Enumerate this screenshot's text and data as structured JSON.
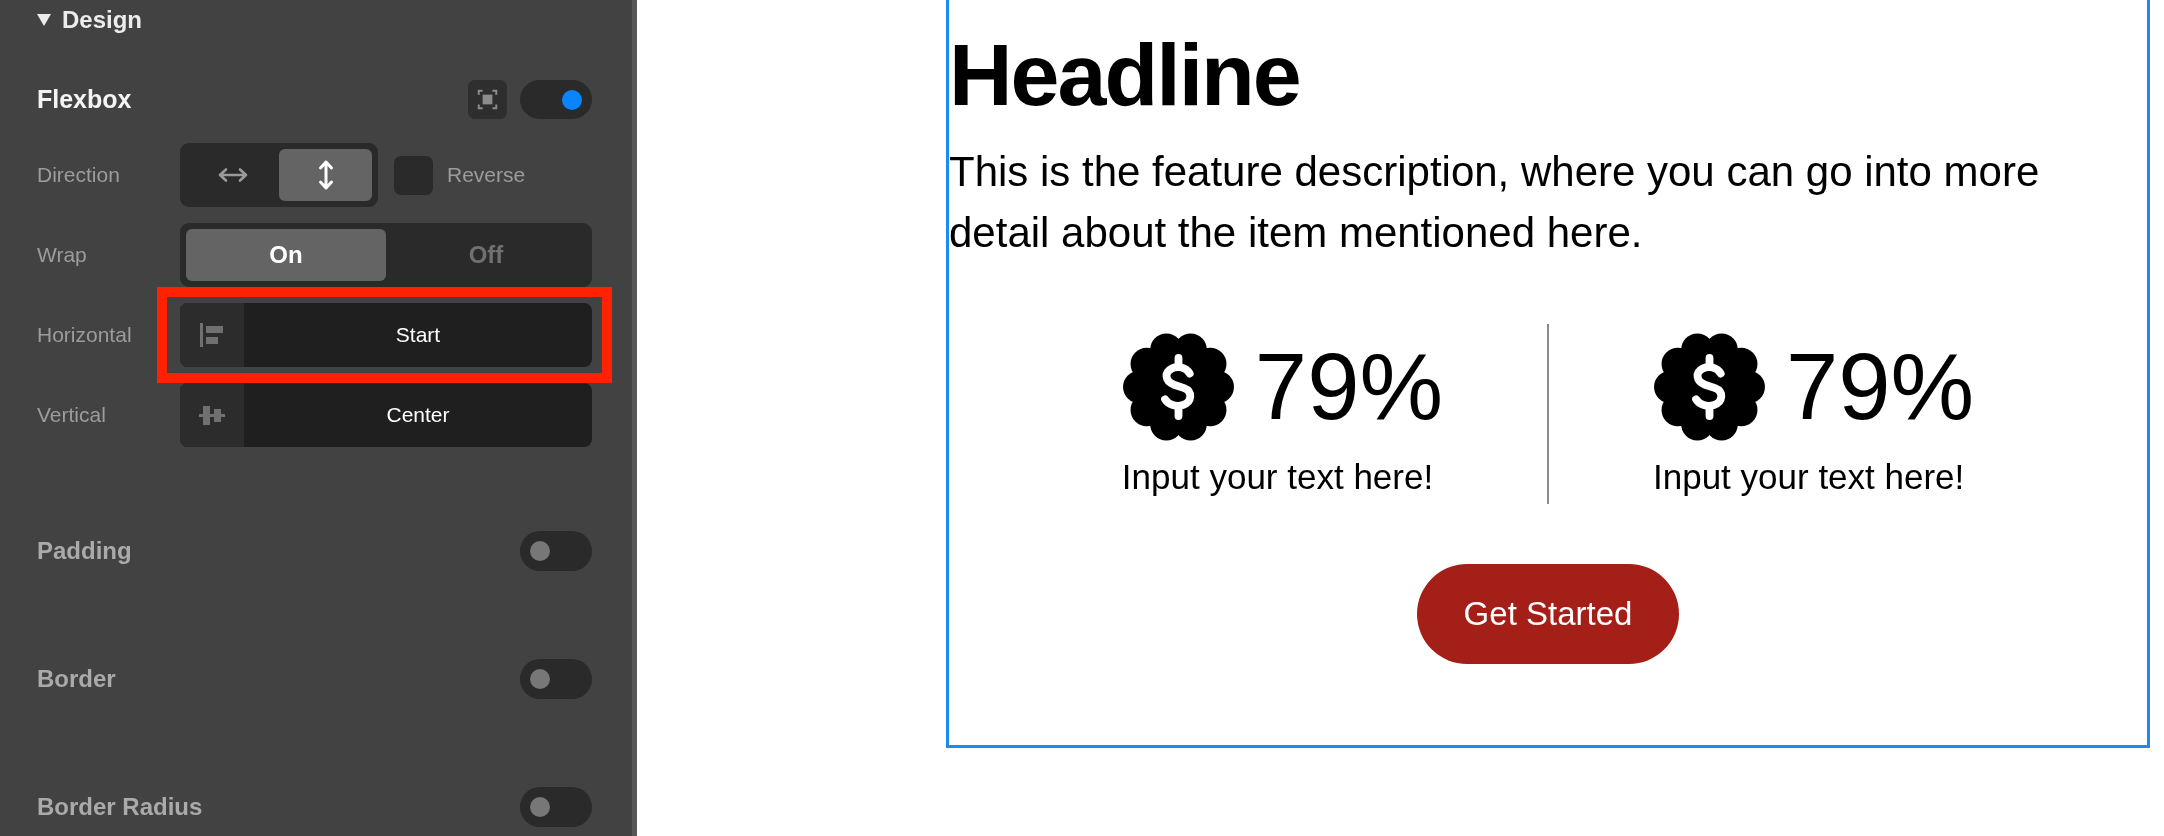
{
  "panel": {
    "section": {
      "title": "Design",
      "expanded": true
    },
    "flexbox": {
      "title": "Flexbox",
      "on": true
    },
    "controls": [
      {
        "kind": "direction",
        "label": "Direction",
        "options": [
          {
            "kind": "row",
            "selected": false
          },
          {
            "kind": "column",
            "selected": true
          }
        ],
        "reverse": {
          "label": "Reverse",
          "checked": false
        }
      },
      {
        "kind": "wrap",
        "label": "Wrap",
        "options": [
          {
            "label": "On",
            "selected": true
          },
          {
            "label": "Off",
            "selected": false
          }
        ]
      },
      {
        "kind": "halign",
        "label": "Horizontal",
        "value": "Start",
        "highlighted": true
      },
      {
        "kind": "valign",
        "label": "Vertical",
        "value": "Center",
        "highlighted": false
      }
    ],
    "sections": [
      {
        "title": "Padding",
        "on": false
      },
      {
        "title": "Border",
        "on": false
      },
      {
        "title": "Border Radius",
        "on": false
      }
    ]
  },
  "canvas": {
    "selected": true,
    "headline": "Headline",
    "description": "This is the feature description, where you can go into more detail about the item mentioned here.",
    "stats": [
      {
        "value": "79%",
        "caption": "Input your text here!"
      },
      {
        "value": "79%",
        "caption": "Input your text here!"
      }
    ],
    "button": "Get Started"
  }
}
